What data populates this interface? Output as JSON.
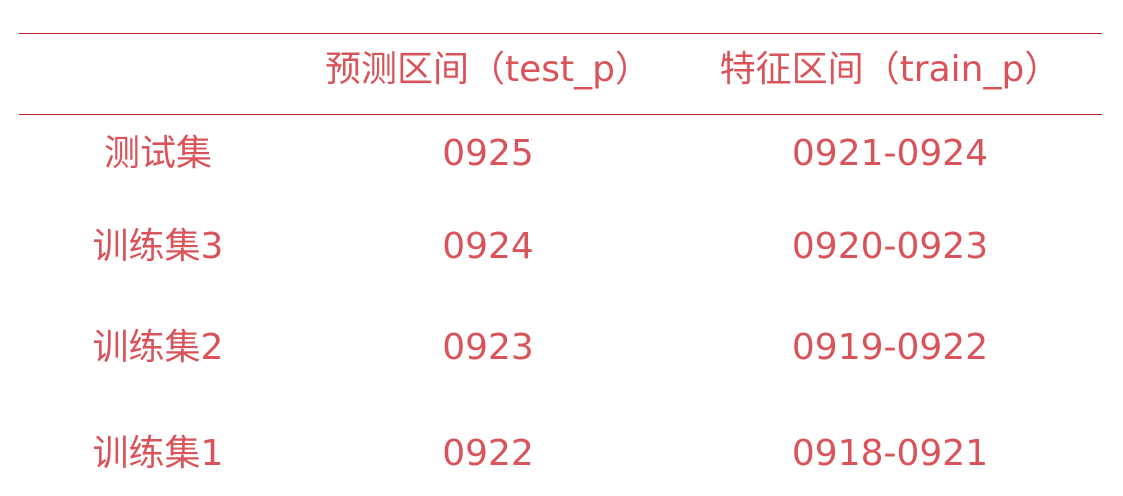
{
  "table": {
    "headers": [
      "",
      "预测区间（test_p）",
      "特征区间（train_p）"
    ],
    "rows": [
      [
        "测试集",
        "0925",
        "0921-0924"
      ],
      [
        "训练集3",
        "0924",
        "0920-0923"
      ],
      [
        "训练集2",
        "0923",
        "0919-0922"
      ],
      [
        "训练集1",
        "0922",
        "0918-0921"
      ]
    ]
  },
  "colors": {
    "text": "#d9545a",
    "rule": "#b8262c"
  }
}
